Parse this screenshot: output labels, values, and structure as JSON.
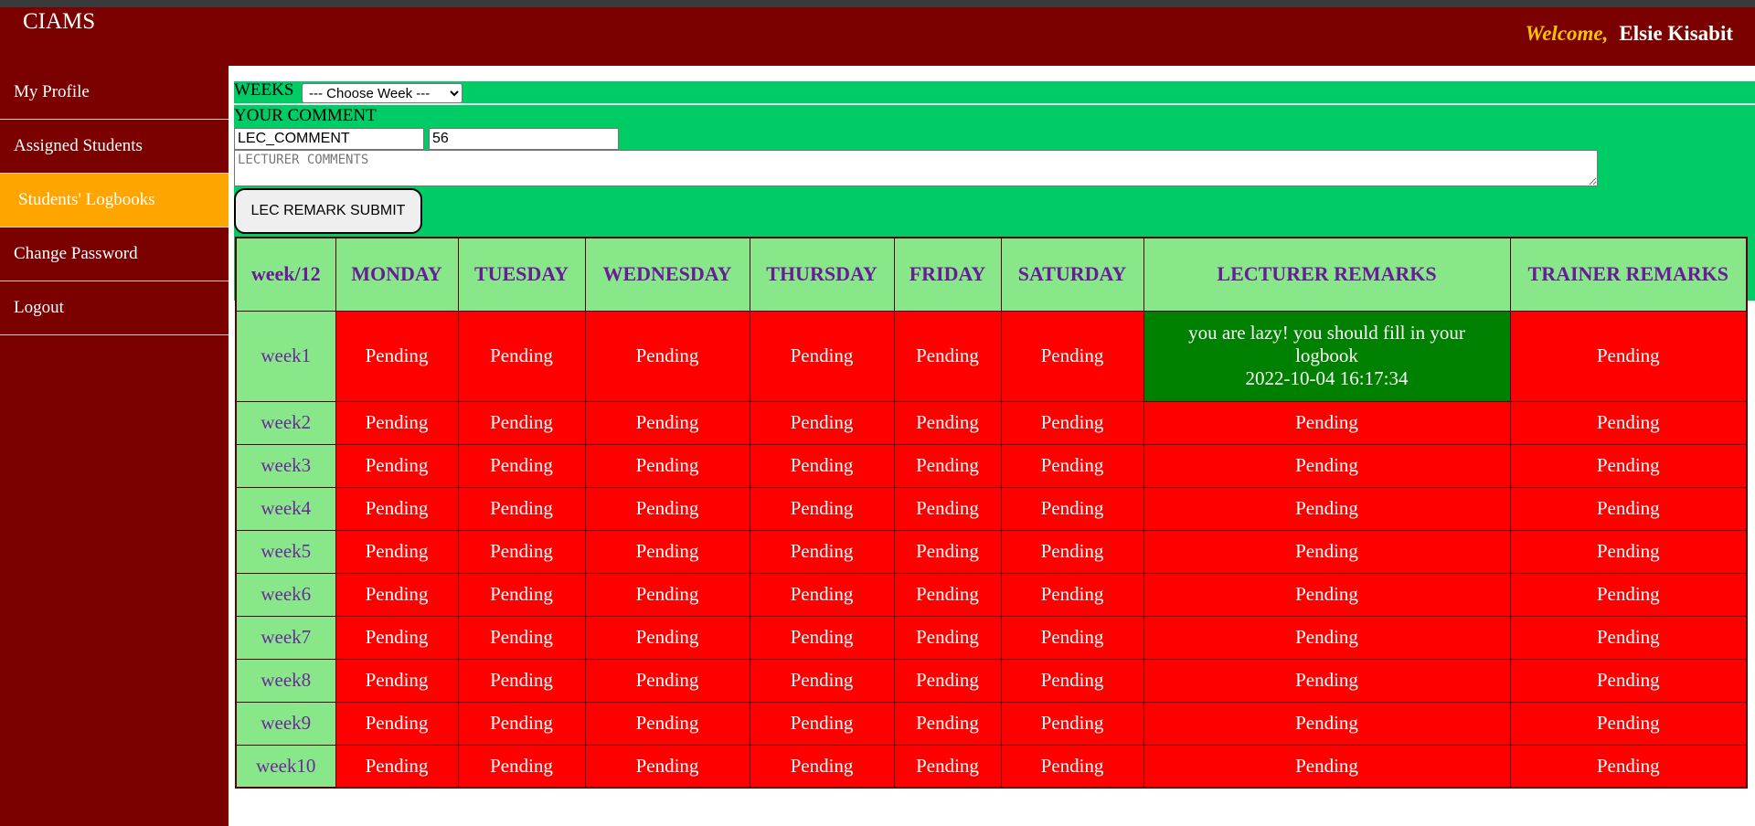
{
  "app": {
    "title": "CIAMS"
  },
  "header": {
    "welcome_label": "Welcome,",
    "user_name": "Elsie Kisabit"
  },
  "sidebar": {
    "items": [
      {
        "label": "My Profile",
        "active": false
      },
      {
        "label": "Assigned Students",
        "active": false
      },
      {
        "label": "Students' Logbooks",
        "active": true
      },
      {
        "label": "Change Password",
        "active": false
      },
      {
        "label": "Logout",
        "active": false
      }
    ]
  },
  "form": {
    "weeks_label": "WEEKS",
    "week_select_value": "--- Choose Week ---",
    "comment_label": "YOUR COMMENT",
    "field1_value": "LEC_COMMENT",
    "field2_value": "56",
    "textarea_placeholder": "LECTURER COMMENTS",
    "submit_label": "LEC REMARK SUBMIT"
  },
  "table": {
    "headers": [
      "week/12",
      "MONDAY",
      "TUESDAY",
      "WEDNESDAY",
      "THURSDAY",
      "FRIDAY",
      "SATURDAY",
      "LECTURER REMARKS",
      "TRAINER REMARKS"
    ],
    "rows": [
      {
        "week": "week1",
        "days": [
          "Pending",
          "Pending",
          "Pending",
          "Pending",
          "Pending",
          "Pending"
        ],
        "lecturer_remark": "you are lazy! you should fill in your logbook",
        "lecturer_remark_time": "2022-10-04 16:17:34",
        "trainer_remark": "Pending"
      },
      {
        "week": "week2",
        "days": [
          "Pending",
          "Pending",
          "Pending",
          "Pending",
          "Pending",
          "Pending"
        ],
        "lecturer_remark": "Pending",
        "trainer_remark": "Pending"
      },
      {
        "week": "week3",
        "days": [
          "Pending",
          "Pending",
          "Pending",
          "Pending",
          "Pending",
          "Pending"
        ],
        "lecturer_remark": "Pending",
        "trainer_remark": "Pending"
      },
      {
        "week": "week4",
        "days": [
          "Pending",
          "Pending",
          "Pending",
          "Pending",
          "Pending",
          "Pending"
        ],
        "lecturer_remark": "Pending",
        "trainer_remark": "Pending"
      },
      {
        "week": "week5",
        "days": [
          "Pending",
          "Pending",
          "Pending",
          "Pending",
          "Pending",
          "Pending"
        ],
        "lecturer_remark": "Pending",
        "trainer_remark": "Pending"
      },
      {
        "week": "week6",
        "days": [
          "Pending",
          "Pending",
          "Pending",
          "Pending",
          "Pending",
          "Pending"
        ],
        "lecturer_remark": "Pending",
        "trainer_remark": "Pending"
      },
      {
        "week": "week7",
        "days": [
          "Pending",
          "Pending",
          "Pending",
          "Pending",
          "Pending",
          "Pending"
        ],
        "lecturer_remark": "Pending",
        "trainer_remark": "Pending"
      },
      {
        "week": "week8",
        "days": [
          "Pending",
          "Pending",
          "Pending",
          "Pending",
          "Pending",
          "Pending"
        ],
        "lecturer_remark": "Pending",
        "trainer_remark": "Pending"
      },
      {
        "week": "week9",
        "days": [
          "Pending",
          "Pending",
          "Pending",
          "Pending",
          "Pending",
          "Pending"
        ],
        "lecturer_remark": "Pending",
        "trainer_remark": "Pending"
      },
      {
        "week": "week10",
        "days": [
          "Pending",
          "Pending",
          "Pending",
          "Pending",
          "Pending",
          "Pending"
        ],
        "lecturer_remark": "Pending",
        "trainer_remark": "Pending"
      }
    ]
  },
  "colors": {
    "header_bg": "#7b0000",
    "active_nav": "#ffa500",
    "form_bg": "#00cc66",
    "table_header_bg": "#88e788",
    "pending_bg": "#ff0000",
    "remark_ok_bg": "#008000",
    "header_text": "#6a1b9a"
  }
}
